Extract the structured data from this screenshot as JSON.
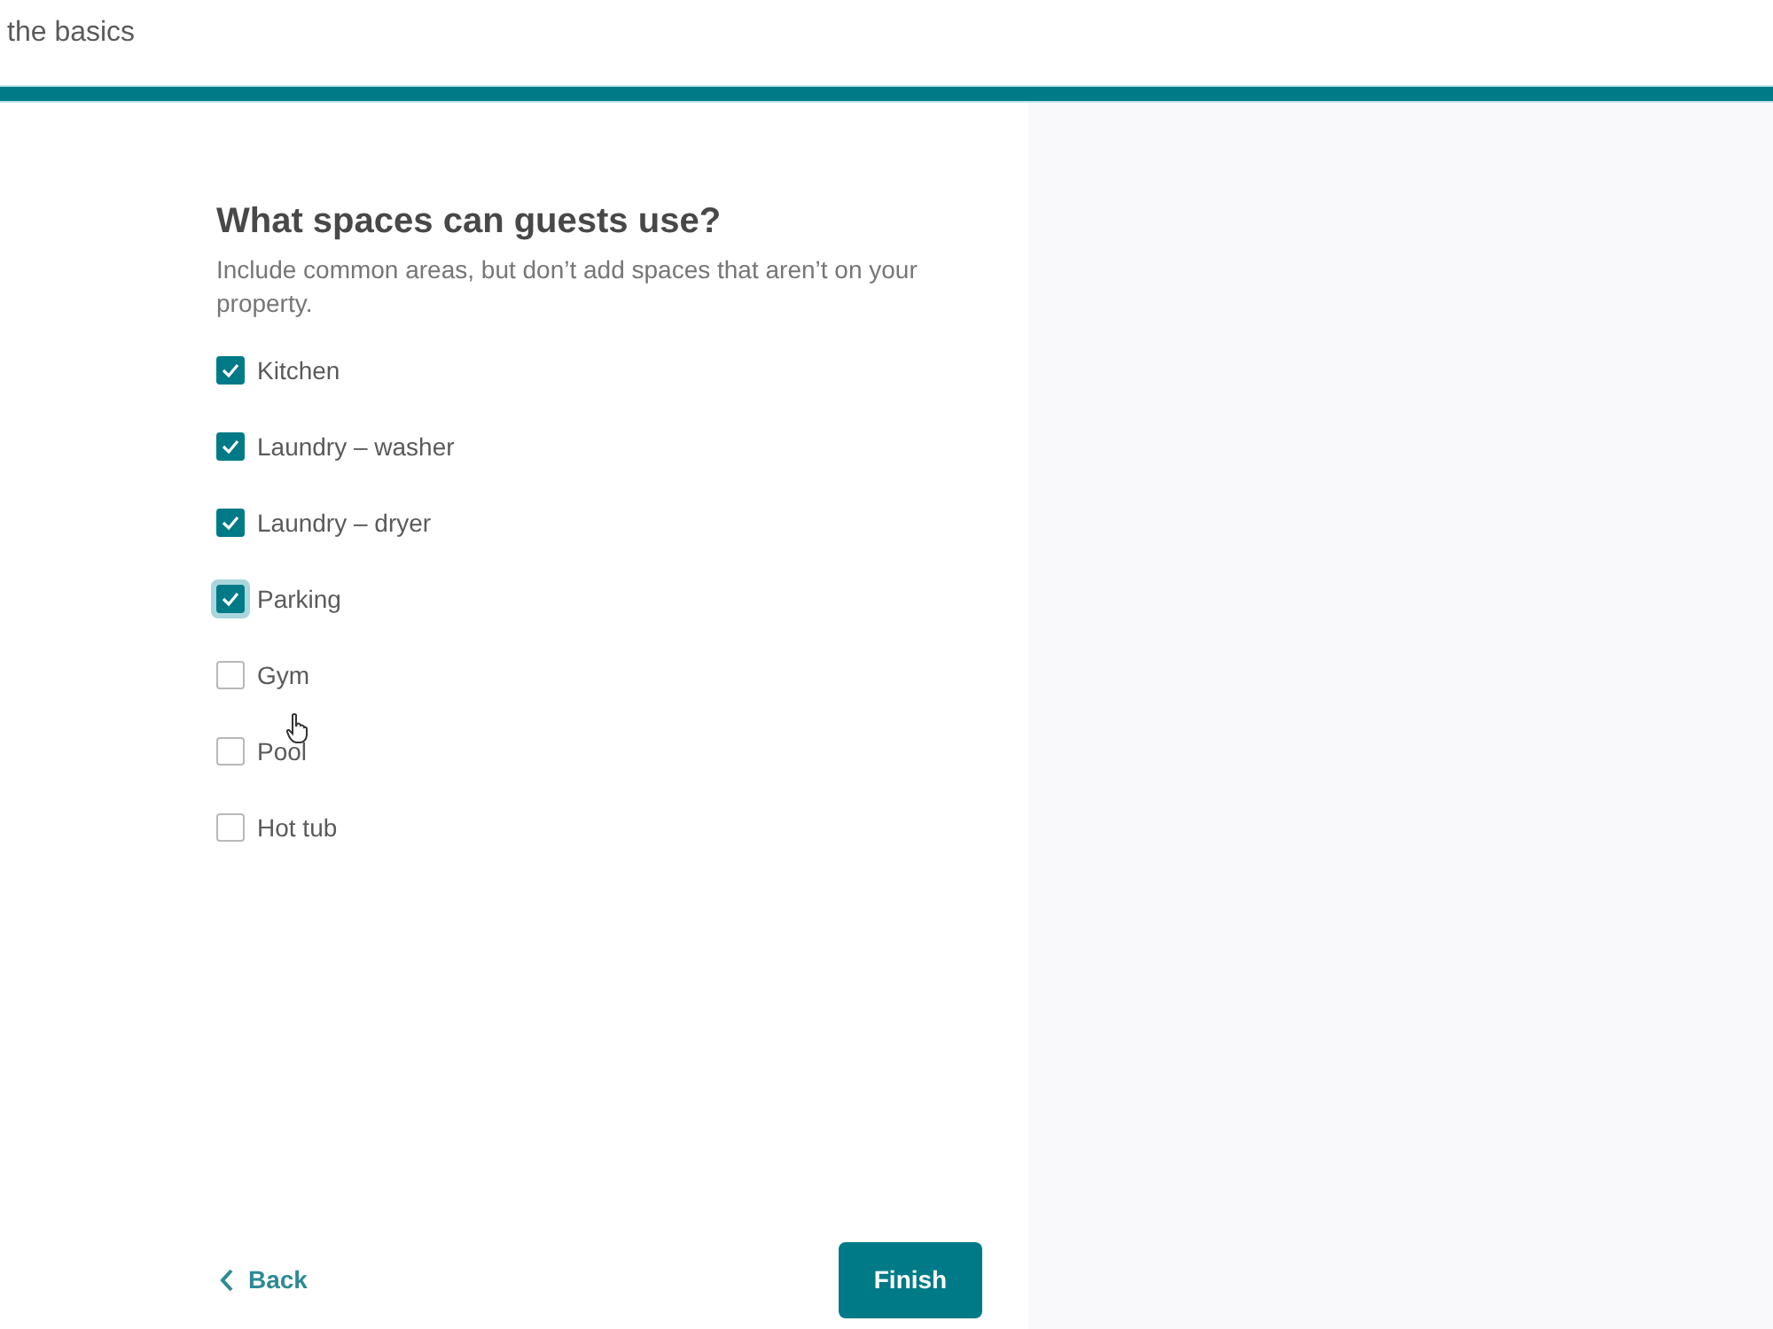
{
  "header": {
    "title": "the basics"
  },
  "progress": {
    "level": 1
  },
  "heading": "What spaces can guests use?",
  "description": "Include common areas, but don’t add spaces that aren’t on your property.",
  "spaces": [
    {
      "label": "Kitchen",
      "checked": true,
      "focused": false
    },
    {
      "label": "Laundry – washer",
      "checked": true,
      "focused": false
    },
    {
      "label": "Laundry – dryer",
      "checked": true,
      "focused": false
    },
    {
      "label": "Parking",
      "checked": true,
      "focused": true
    },
    {
      "label": "Gym",
      "checked": false,
      "focused": false
    },
    {
      "label": "Pool",
      "checked": false,
      "focused": false
    },
    {
      "label": "Hot tub",
      "checked": false,
      "focused": false
    }
  ],
  "footer": {
    "back": "Back",
    "finish": "Finish"
  }
}
